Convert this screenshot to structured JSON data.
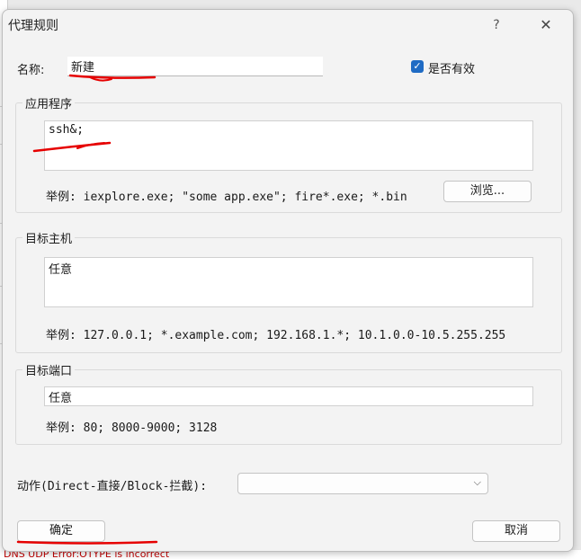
{
  "dialog": {
    "title": "代理规则",
    "help_glyph": "?",
    "close_glyph": "✕"
  },
  "name": {
    "label": "名称:",
    "value": "新建"
  },
  "enabled": {
    "label": "是否有效",
    "checked": true
  },
  "applications": {
    "title": "应用程序",
    "value": "ssh&;",
    "example": "举例: iexplore.exe; \"some app.exe\"; fire*.exe; *.bin",
    "browse_label": "浏览..."
  },
  "target_host": {
    "title": "目标主机",
    "value": "任意",
    "example": "举例: 127.0.0.1; *.example.com; 192.168.1.*; 10.1.0.0-10.5.255.255"
  },
  "target_port": {
    "title": "目标端口",
    "value": "任意",
    "example": "举例: 80; 8000-9000; 3128"
  },
  "action": {
    "label": "动作(Direct-直接/Block-拦截):",
    "selected": ""
  },
  "buttons": {
    "ok": "确定",
    "cancel": "取消"
  },
  "background": {
    "bottom_text": "DNS UDP Error:OTYPE is incorrect"
  },
  "colors": {
    "accent": "#1f6bc4",
    "annotation": "#e60000"
  }
}
